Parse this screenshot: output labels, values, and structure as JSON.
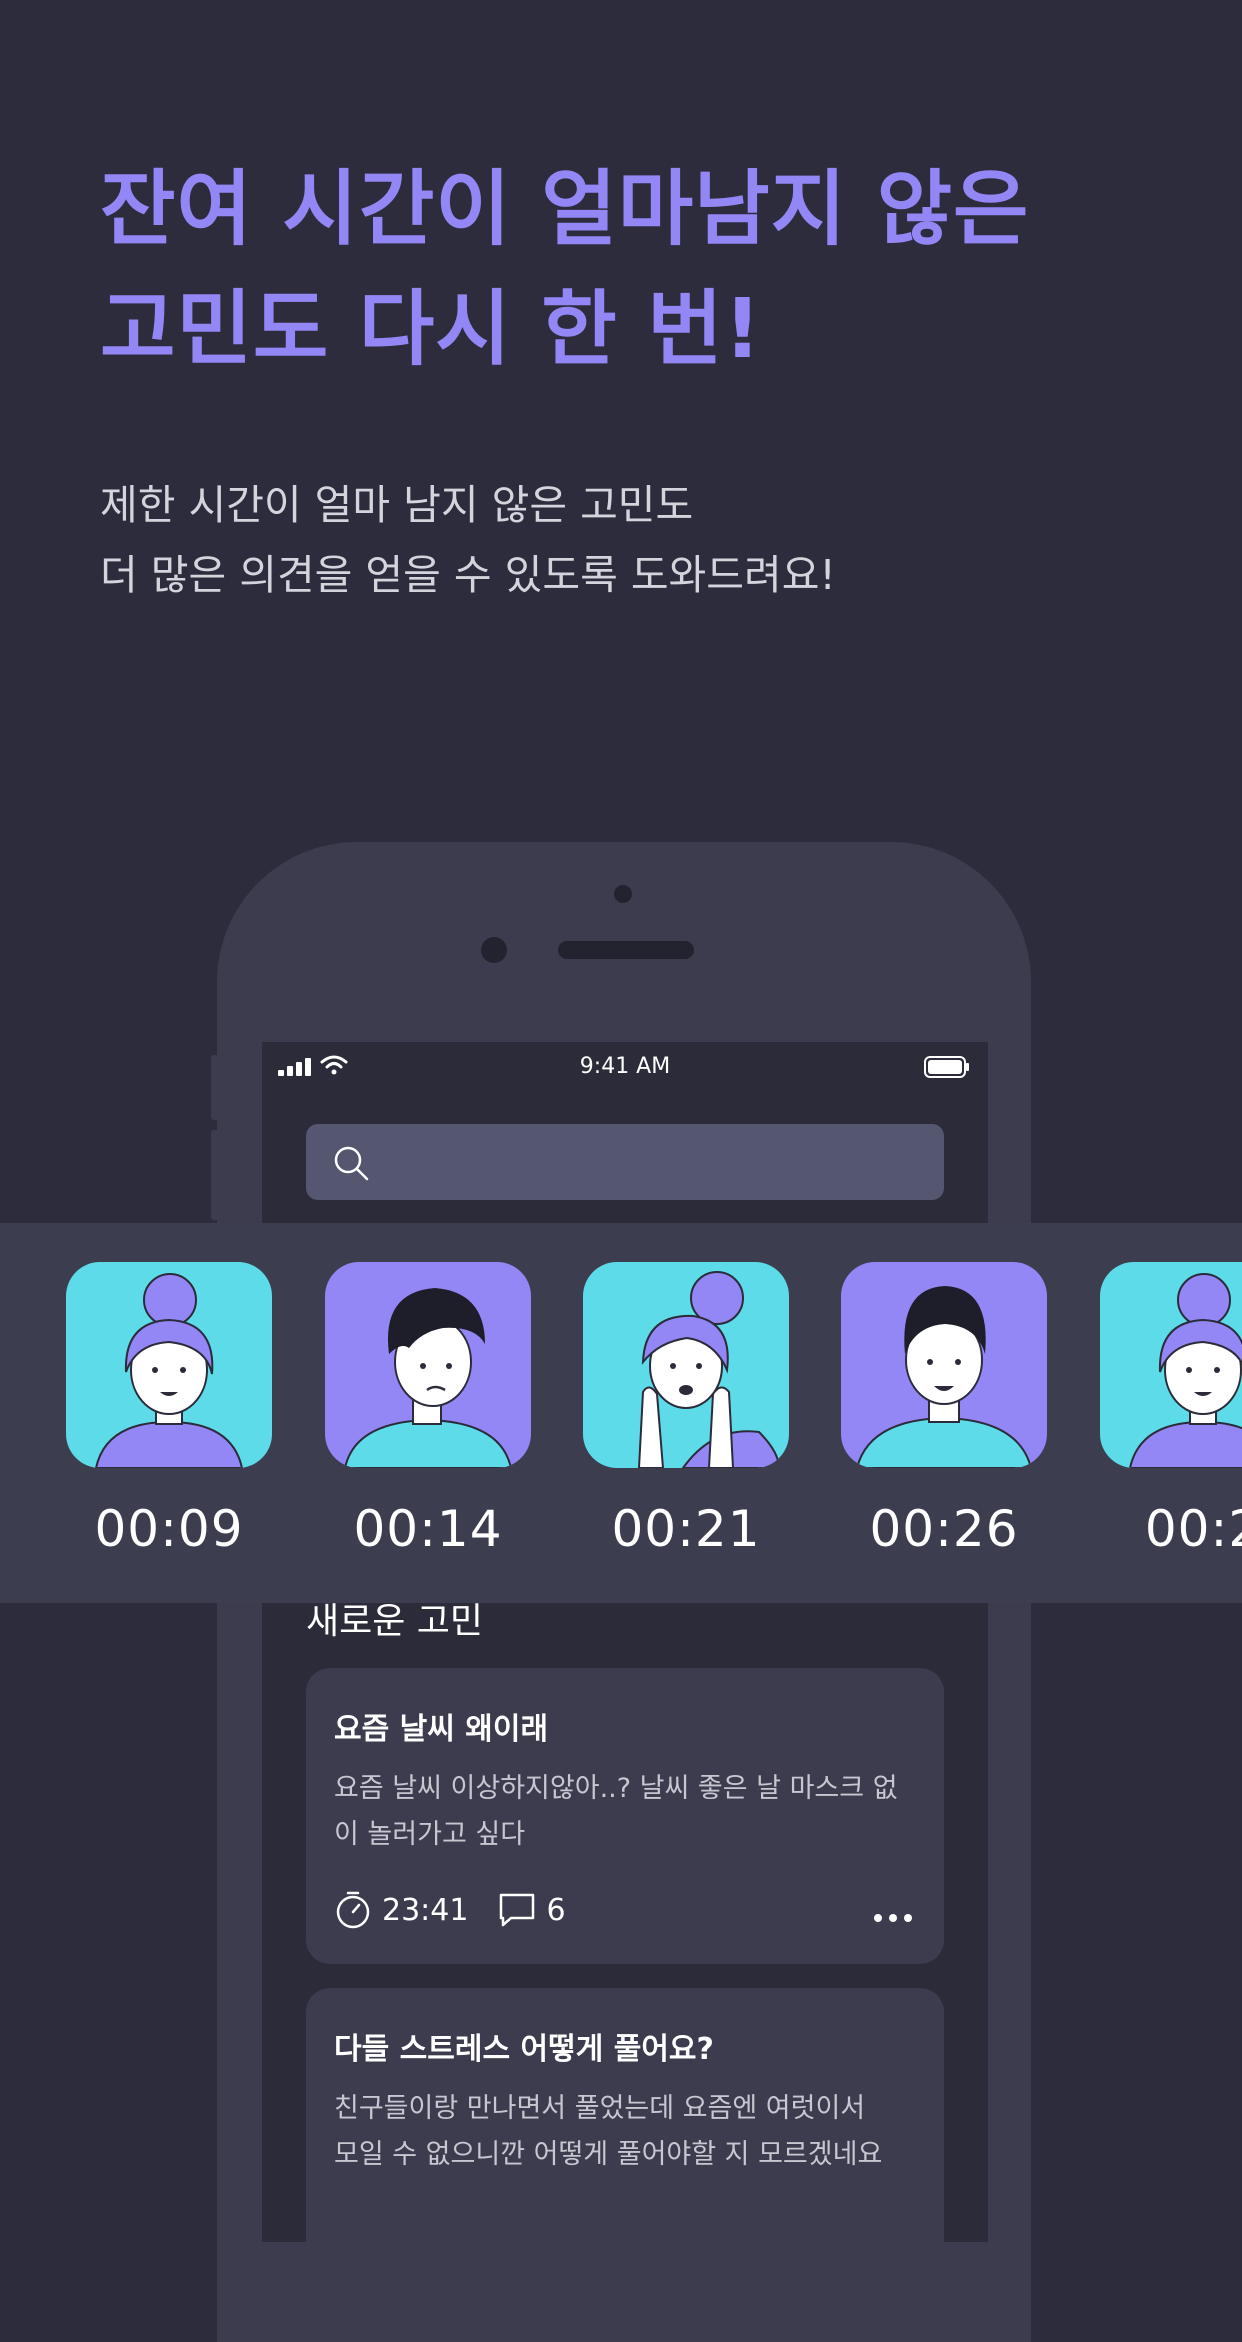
{
  "headline": {
    "line1": "잔여 시간이 얼마남지 않은",
    "line2": "고민도 다시 한 번!"
  },
  "subtext": {
    "line1": "제한 시간이 얼마 남지 않은 고민도",
    "line2": "더 많은 의견을 얻을 수 있도록 도와드려요!"
  },
  "status_bar": {
    "time": "9:41 AM"
  },
  "avatars": [
    {
      "time": "00:09",
      "bg": "#5ddbe8"
    },
    {
      "time": "00:14",
      "bg": "#9386f5"
    },
    {
      "time": "00:21",
      "bg": "#5ddbe8"
    },
    {
      "time": "00:26",
      "bg": "#9386f5"
    },
    {
      "time": "00:2",
      "bg": "#5ddbe8"
    }
  ],
  "section": {
    "title": "새로운 고민"
  },
  "posts": [
    {
      "title": "요즘 날씨 왜이래",
      "body_line1": "요즘 날씨 이상하지않아..? 날씨 좋은 날 마스크 없",
      "body_line2": "이 놀러가고 싶다",
      "time_left": "23:41",
      "comments": "6"
    },
    {
      "title": "다들 스트레스 어떻게 풀어요?",
      "body_line1": "친구들이랑 만나면서 풀었는데 요즘엔 여럿이서",
      "body_line2": "모일 수 없으니깐 어떻게 풀어야할 지 모르겠네요"
    }
  ],
  "colors": {
    "accent": "#9386f5",
    "cyan": "#5ddbe8",
    "background": "#2c2c3c",
    "phone": "#3c3c4e"
  },
  "icons": {
    "search": "search-icon",
    "timer": "stopwatch-icon",
    "comment": "comment-icon",
    "more": "more-icon"
  }
}
